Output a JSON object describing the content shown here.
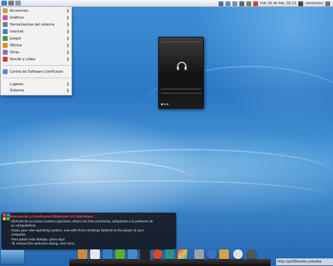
{
  "top_panel": {
    "clock": "mié 16 de feb, 02:13",
    "user": "comfusion"
  },
  "app_menu": {
    "items": [
      {
        "label": "Accesorios",
        "icon": "accessories-icon",
        "color": "#c8a04a"
      },
      {
        "label": "Gráficos",
        "icon": "graphics-icon",
        "color": "#d24fa4"
      },
      {
        "label": "Herramientas del sistema",
        "icon": "system-tools-icon",
        "color": "#7a7f86"
      },
      {
        "label": "Internet",
        "icon": "internet-icon",
        "color": "#3d7fd0"
      },
      {
        "label": "Juegos",
        "icon": "games-icon",
        "color": "#3f9b3f"
      },
      {
        "label": "Oficina",
        "icon": "office-icon",
        "color": "#d98c2b"
      },
      {
        "label": "Otras",
        "icon": "other-icon",
        "color": "#8a6db5"
      },
      {
        "label": "Sonido y vídeo",
        "icon": "sound-video-icon",
        "color": "#c54040"
      }
    ],
    "software_center": {
      "label": "Centro de Software ComFusion",
      "icon": "software-center-icon",
      "color": "#4a8ad6"
    },
    "places": "Lugares",
    "system": "Sistema"
  },
  "welcome_dialog": {
    "title": "Bienvenido a ComFusion!/Welcome to ComFusion!",
    "lines": [
      "- Disfrute de su  nuevo sistema operativo, ahora con tres escritorios, adaptados a la potencia de",
      "su computadora.",
      "- Enjoy your new operating system, now with three desktops tailored to the power of your",
      "computer.",
      "- Para quitar este dialogo, pulse aquí.",
      "- To remove this welcome dialog, click here."
    ]
  },
  "dock": {
    "icons": [
      {
        "name": "dock-icon-files",
        "color": "#c98a3d"
      },
      {
        "name": "dock-icon-panda",
        "color": "#e8e8e8"
      },
      {
        "name": "dock-icon-bluefish",
        "color": "#3a7cc4"
      },
      {
        "name": "dock-icon-nvidia",
        "color": "#5fae30"
      },
      {
        "name": "dock-icon-calendar",
        "color": "#4b86c8"
      },
      {
        "name": "dock-icon-terminal",
        "color": "#222222"
      },
      {
        "name": "dock-icon-media",
        "color": "#d94a2c"
      },
      {
        "name": "dock-icon-network",
        "color": "#2f8f8f"
      },
      {
        "name": "dock-icon-palette",
        "color": "#c8408f"
      },
      {
        "name": "dock-icon-screen",
        "color": "#9aa3ad"
      },
      {
        "name": "dock-icon-globe",
        "color": "#3c73c0"
      },
      {
        "name": "dock-icon-folder",
        "color": "#d6a24a"
      },
      {
        "name": "dock-icon-disc",
        "color": "#e0e0e0"
      },
      {
        "name": "dock-icon-power",
        "color": "#555555"
      }
    ]
  },
  "corner_url": "http://pr09studio.yolasite"
}
